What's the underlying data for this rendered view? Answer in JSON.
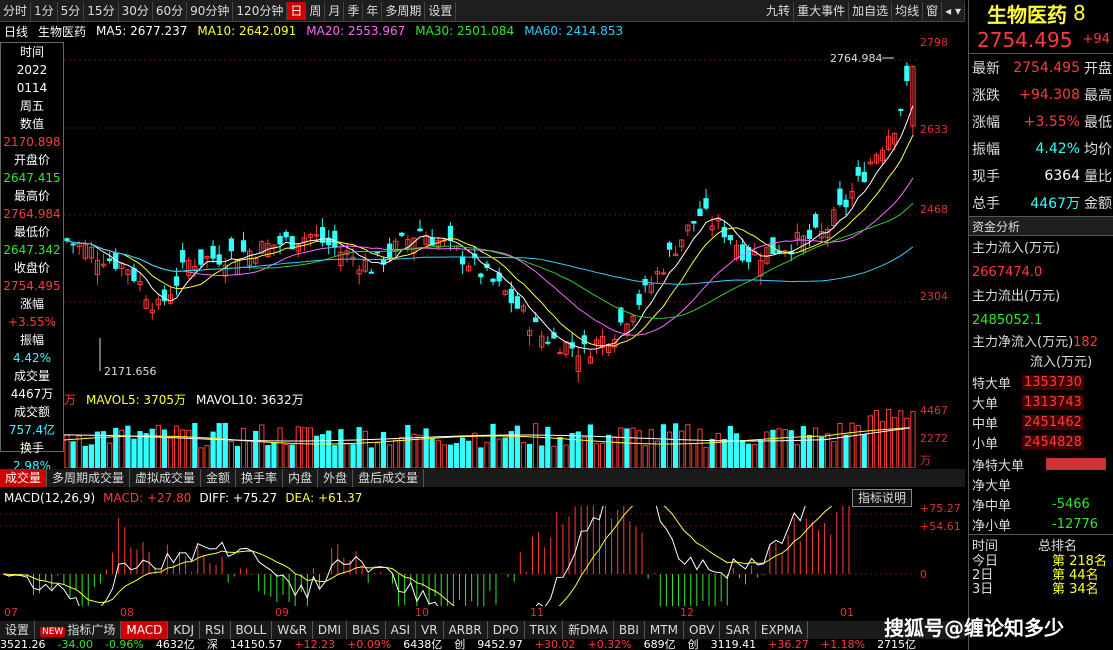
{
  "toolbar": {
    "periods": [
      "分时",
      "1分",
      "5分",
      "15分",
      "30分",
      "60分",
      "90分钟",
      "120分钟",
      "日",
      "周",
      "月",
      "季",
      "年",
      "多周期",
      "设置"
    ],
    "active_period": "日",
    "right_items": [
      "九转",
      "重大事件",
      "加自选",
      "均线",
      "窗"
    ]
  },
  "ma_bar": {
    "type": "日线",
    "name": "生物医药",
    "ma5": "MA5: 2677.237",
    "ma10": "MA10: 2642.091",
    "ma20": "MA20: 2553.967",
    "ma30": "MA30: 2501.084",
    "ma60": "MA60: 2414.853"
  },
  "left_panel": {
    "rows": [
      {
        "text": "时间",
        "color": "white"
      },
      {
        "text": "2022",
        "color": "white"
      },
      {
        "text": "0114",
        "color": "white"
      },
      {
        "text": "周五",
        "color": "white"
      },
      {
        "text": "数值",
        "color": "white"
      },
      {
        "text": "2170.898",
        "color": "red"
      },
      {
        "text": "开盘价",
        "color": "white"
      },
      {
        "text": "2647.415",
        "color": "green"
      },
      {
        "text": "最高价",
        "color": "white"
      },
      {
        "text": "2764.984",
        "color": "red"
      },
      {
        "text": "最低价",
        "color": "white"
      },
      {
        "text": "2647.342",
        "color": "green"
      },
      {
        "text": "收盘价",
        "color": "white"
      },
      {
        "text": "2754.495",
        "color": "red"
      },
      {
        "text": "涨幅",
        "color": "white"
      },
      {
        "text": "+3.55%",
        "color": "red"
      },
      {
        "text": "振幅",
        "color": "white"
      },
      {
        "text": "4.42%",
        "color": "cyan"
      },
      {
        "text": "成交量",
        "color": "white"
      },
      {
        "text": "4467万",
        "color": "white"
      },
      {
        "text": "成交额",
        "color": "white"
      },
      {
        "text": "757.4亿",
        "color": "cyan"
      },
      {
        "text": "换手",
        "color": "white"
      },
      {
        "text": "2.98%",
        "color": "cyan"
      }
    ]
  },
  "price_axis": [
    "2798",
    "2633",
    "2468",
    "2304"
  ],
  "annotations": {
    "high": "2764.984",
    "low": "2171.656"
  },
  "volume": {
    "header_prefix": "万",
    "mavol5": "MAVOL5: 3705万",
    "mavol10": "MAVOL10: 3632万",
    "axis": [
      "4467",
      "2272",
      "万"
    ]
  },
  "sub_tabs": [
    "成交量",
    "多周期成交量",
    "虚拟成交量",
    "金额",
    "换手率",
    "内盘",
    "外盘",
    "盘后成交量"
  ],
  "macd": {
    "label": "MACD(12,26,9)",
    "macd": "MACD: +27.80",
    "diff": "DIFF: +75.27",
    "dea": "DEA: +61.37",
    "axis": [
      "+75.27",
      "+54.61",
      "0"
    ],
    "help_button": "指标说明"
  },
  "x_axis": [
    "07",
    "08",
    "09",
    "10",
    "11",
    "12",
    "01"
  ],
  "indicator_tabs": [
    "设置",
    "指标广场",
    "MACD",
    "KDJ",
    "RSI",
    "BOLL",
    "W&R",
    "DMI",
    "BIAS",
    "ASI",
    "VR",
    "ARBR",
    "DPO",
    "TRIX",
    "新DMA",
    "BBI",
    "MTM",
    "OBV",
    "SAR",
    "EXPMA"
  ],
  "indicator_new_badge": "NEW",
  "active_indicator": "MACD",
  "status_bar": [
    "3521.26",
    "-34.00",
    "-0.96%",
    "4632亿",
    "深",
    "14150.57",
    "+12.23",
    "+0.09%",
    "6438亿",
    "创",
    "9452.97",
    "+30.02",
    "+0.32%",
    "689亿",
    "创",
    "3119.41",
    "+36.27",
    "+1.18%",
    "2715亿"
  ],
  "right_panel": {
    "title": "生物医药",
    "title_suffix": "8",
    "price": "2754.495",
    "price_suffix": "+94",
    "rows": [
      {
        "label": "最新",
        "value": "2754.495",
        "color": "red",
        "label2": "开盘"
      },
      {
        "label": "涨跌",
        "value": "+94.308",
        "color": "red",
        "label2": "最高"
      },
      {
        "label": "涨幅",
        "value": "+3.55%",
        "color": "red",
        "label2": "最低"
      },
      {
        "label": "振幅",
        "value": "4.42%",
        "color": "cyan",
        "label2": "均价"
      },
      {
        "label": "现手",
        "value": "6364",
        "color": "white",
        "label2": "量比"
      },
      {
        "label": "总手",
        "value": "4467万",
        "color": "cyan",
        "label2": "金额"
      }
    ],
    "fund_section": "资金分析",
    "inflow_label": "主力流入(万元)",
    "inflow_value": "2667474.0",
    "outflow_label": "主力流出(万元)",
    "outflow_value": "2485052.1",
    "net_label": "主力净流入(万元)",
    "net_value": "182",
    "flow_header": "流入(万元)",
    "flow_rows": [
      {
        "label": "特大单",
        "value": "1353730"
      },
      {
        "label": "大单",
        "value": "1313743"
      },
      {
        "label": "中单",
        "value": "2451462"
      },
      {
        "label": "小单",
        "value": "2454828"
      }
    ],
    "net_rows": [
      {
        "label": "净特大单",
        "value": ""
      },
      {
        "label": "净大单",
        "value": ""
      },
      {
        "label": "净中单",
        "value": "-5466"
      },
      {
        "label": "净小单",
        "value": "-12776"
      }
    ],
    "rank_header": [
      "时间",
      "总排名"
    ],
    "rank_rows": [
      {
        "label": "今日",
        "value": "第 218名"
      },
      {
        "label": "2日",
        "value": "第 44名"
      },
      {
        "label": "3日",
        "value": "第 34名"
      }
    ]
  },
  "watermark": "搜狐号@缠论知多少",
  "colors": {
    "up": "#ff3b3b",
    "down": "#33ffff",
    "ma5": "#ffffff",
    "ma10": "#ffff33",
    "ma20": "#ff66ff",
    "ma30": "#33cc33",
    "ma60": "#33ccff"
  }
}
